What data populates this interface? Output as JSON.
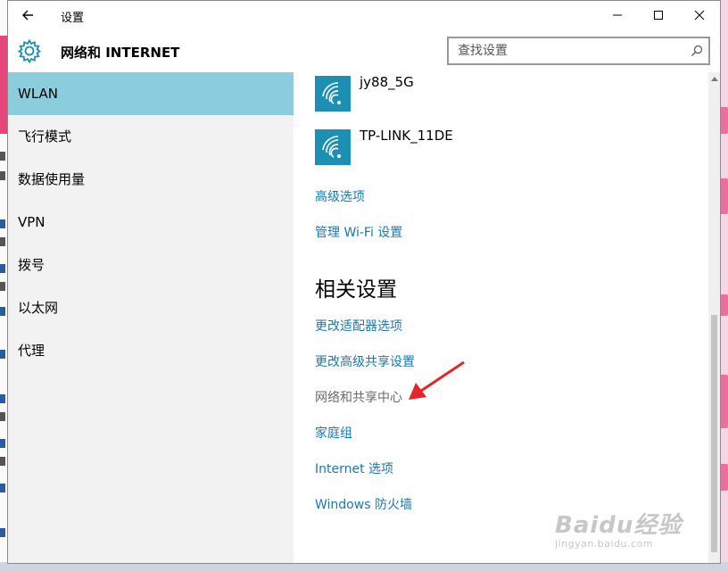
{
  "window": {
    "title": "设置",
    "header_title": "网络和 INTERNET",
    "controls": [
      "minimize-icon",
      "maximize-icon",
      "close-icon"
    ]
  },
  "search": {
    "placeholder": "查找设置",
    "icon": "search-icon"
  },
  "sidebar": {
    "items": [
      {
        "label": "WLAN",
        "active": true
      },
      {
        "label": "飞行模式",
        "active": false
      },
      {
        "label": "数据使用量",
        "active": false
      },
      {
        "label": "VPN",
        "active": false
      },
      {
        "label": "拨号",
        "active": false
      },
      {
        "label": "以太网",
        "active": false
      },
      {
        "label": "代理",
        "active": false
      }
    ]
  },
  "networks": [
    {
      "name": "jy88_5G",
      "icon": "wifi-icon"
    },
    {
      "name": "TP-LINK_11DE",
      "icon": "wifi-icon"
    }
  ],
  "links": {
    "advanced": "高级选项",
    "manage_wifi": "管理 Wi-Fi 设置"
  },
  "related": {
    "title": "相关设置",
    "items": [
      "更改适配器选项",
      "更改高级共享设置",
      "网络和共享中心",
      "家庭组",
      "Internet 选项",
      "Windows 防火墙"
    ]
  },
  "watermark": {
    "logo": "Baidu经验",
    "url": "jingyan.baidu.com"
  },
  "colors": {
    "accent": "#1779b3",
    "selected_nav": "#8ccddd",
    "wifi_tile": "#1c8fb3",
    "annotation_arrow": "#e8232a"
  }
}
